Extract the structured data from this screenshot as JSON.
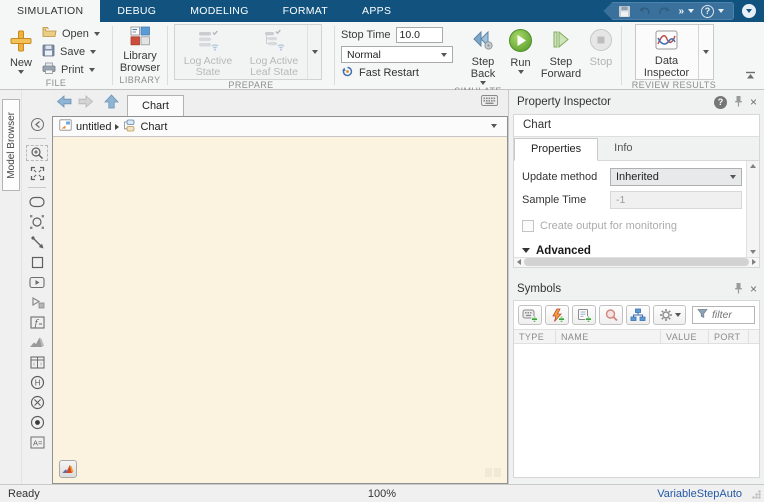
{
  "ribbon": {
    "tabs": [
      {
        "label": "SIMULATION",
        "active": true
      },
      {
        "label": "DEBUG"
      },
      {
        "label": "MODELING"
      },
      {
        "label": "FORMAT"
      },
      {
        "label": "APPS"
      }
    ],
    "file": {
      "new": "New",
      "open": "Open",
      "save": "Save",
      "print": "Print",
      "group": "FILE"
    },
    "library": {
      "label": "Library Browser",
      "group": "LIBRARY"
    },
    "prepare": {
      "log_active_state": "Log Active State",
      "log_active_leaf_state": "Log Active Leaf State",
      "group": "PREPARE"
    },
    "simulate": {
      "stop_time_label": "Stop Time",
      "stop_time_value": "10.0",
      "mode_value": "Normal",
      "fast_restart": "Fast Restart",
      "step_back": "Step Back",
      "run": "Run",
      "step_forward": "Step Forward",
      "stop": "Stop",
      "group": "SIMULATE"
    },
    "review": {
      "data_inspector": "Data Inspector",
      "group": "REVIEW RESULTS"
    }
  },
  "editor": {
    "model_browser": "Model Browser",
    "tab": "Chart",
    "breadcrumb_model": "untitled",
    "breadcrumb_node": "Chart"
  },
  "property_inspector": {
    "title": "Property Inspector",
    "header": "Chart",
    "tab_properties": "Properties",
    "tab_info": "Info",
    "update_method_label": "Update method",
    "update_method_value": "Inherited",
    "sample_time_label": "Sample Time",
    "sample_time_value": "-1",
    "monitor_label": "Create output for monitoring",
    "advanced_label": "Advanced"
  },
  "symbols": {
    "title": "Symbols",
    "filter_placeholder": "filter",
    "col_type": "TYPE",
    "col_name": "NAME",
    "col_value": "VALUE",
    "col_port": "PORT"
  },
  "status": {
    "ready": "Ready",
    "zoom": "100%",
    "solver": "VariableStepAuto"
  },
  "icons": {
    "help": "?",
    "close": "×",
    "more": "»"
  },
  "colors": {
    "tabbar_navy": "#11537E",
    "canvas_cream": "#FBF3E0",
    "run_green": "#5FA832",
    "solver_link_blue": "#2359A5"
  }
}
